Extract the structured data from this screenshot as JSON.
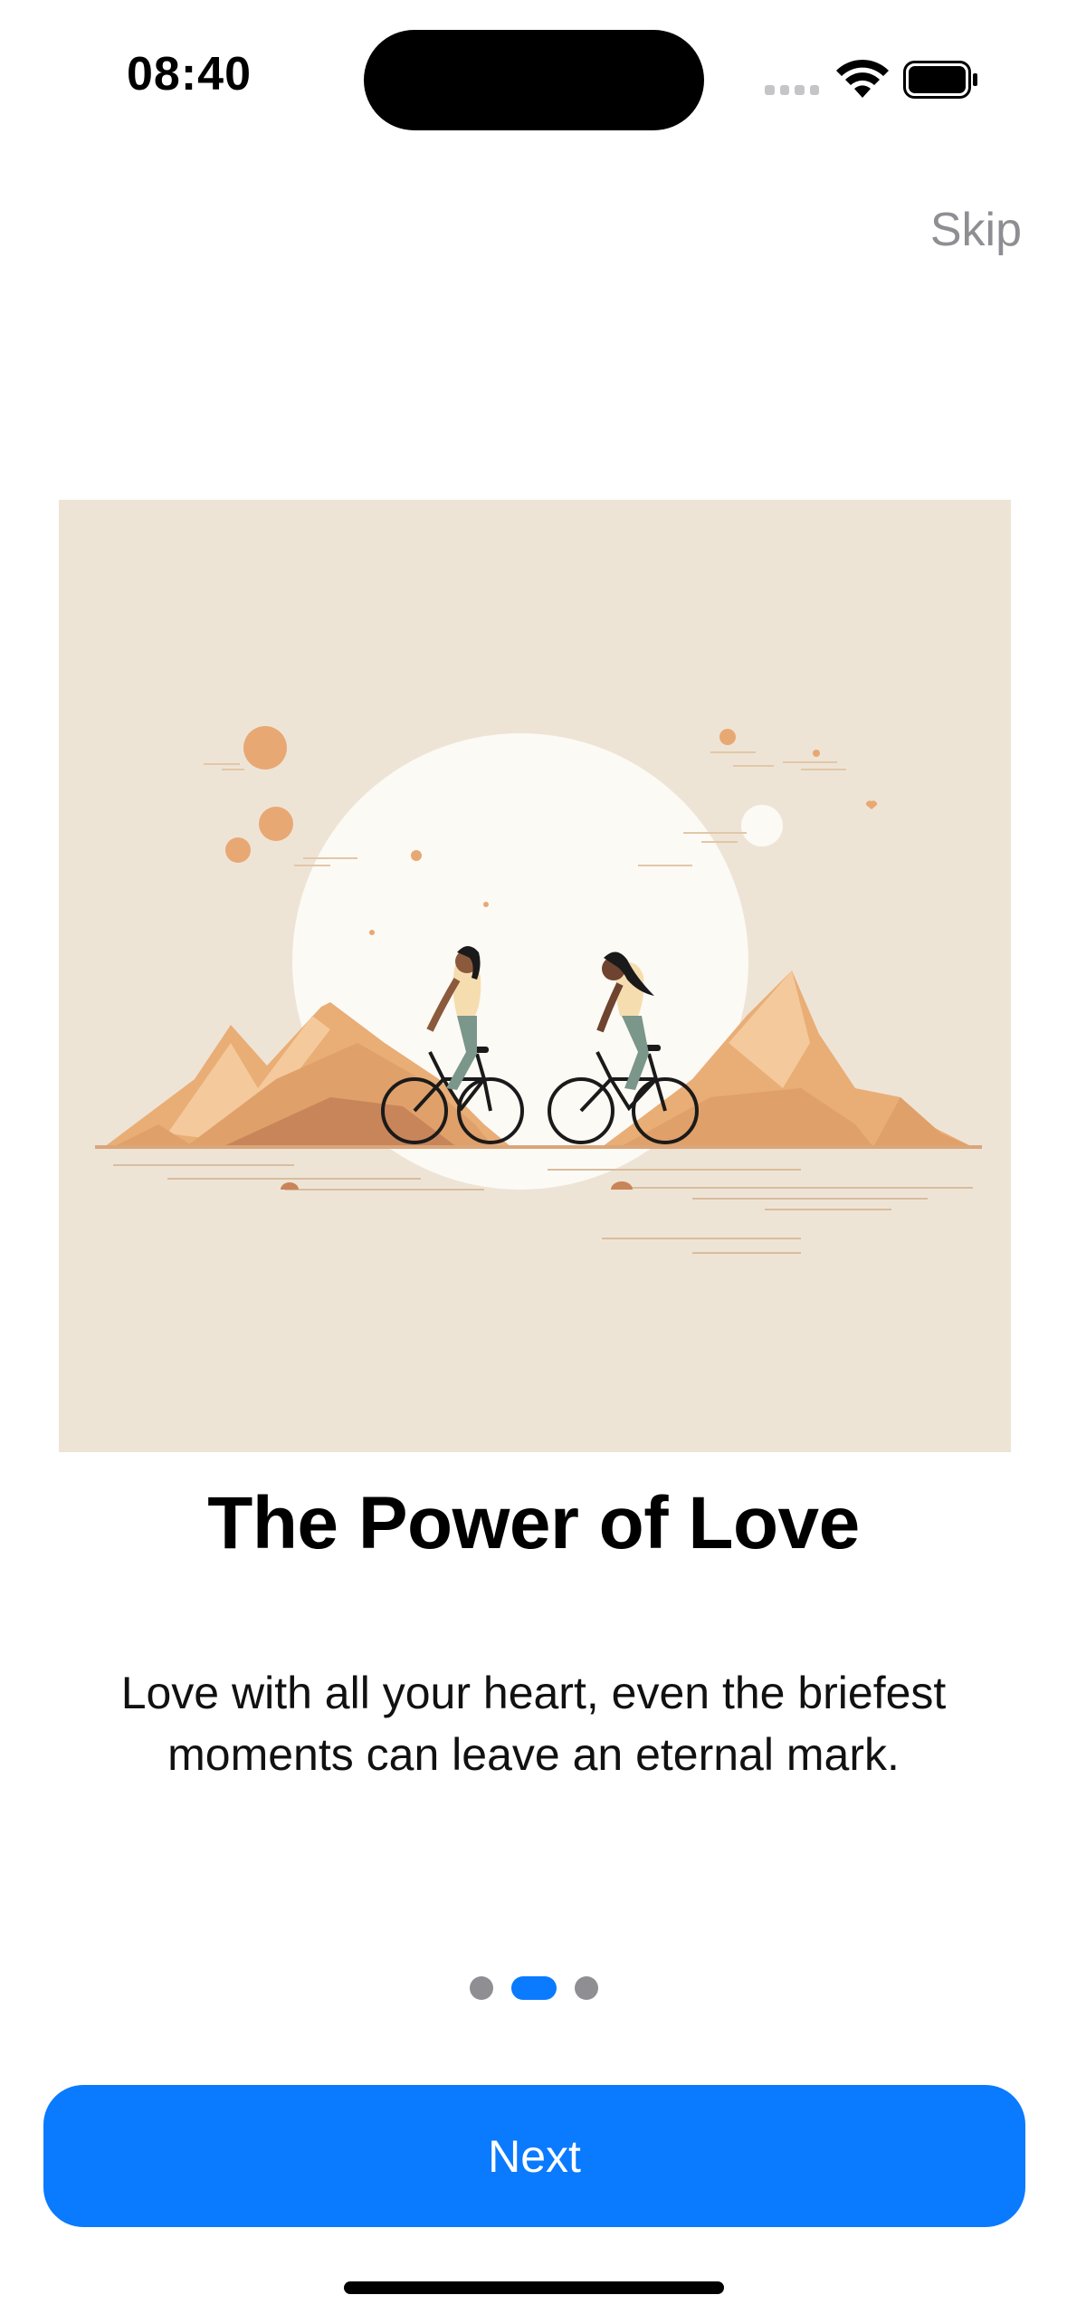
{
  "status_bar": {
    "time": "08:40"
  },
  "header": {
    "skip_label": "Skip"
  },
  "onboarding": {
    "title": "The Power of Love",
    "description": "Love with all your heart, even the briefest moments can leave an eternal mark.",
    "page_count": 3,
    "current_page": 2
  },
  "footer": {
    "next_label": "Next"
  },
  "colors": {
    "accent": "#0a7aff",
    "skip_text": "#8e8e93",
    "illustration_bg": "#eee4d6"
  },
  "icons": [
    "signal-icon",
    "wifi-icon",
    "battery-icon"
  ]
}
